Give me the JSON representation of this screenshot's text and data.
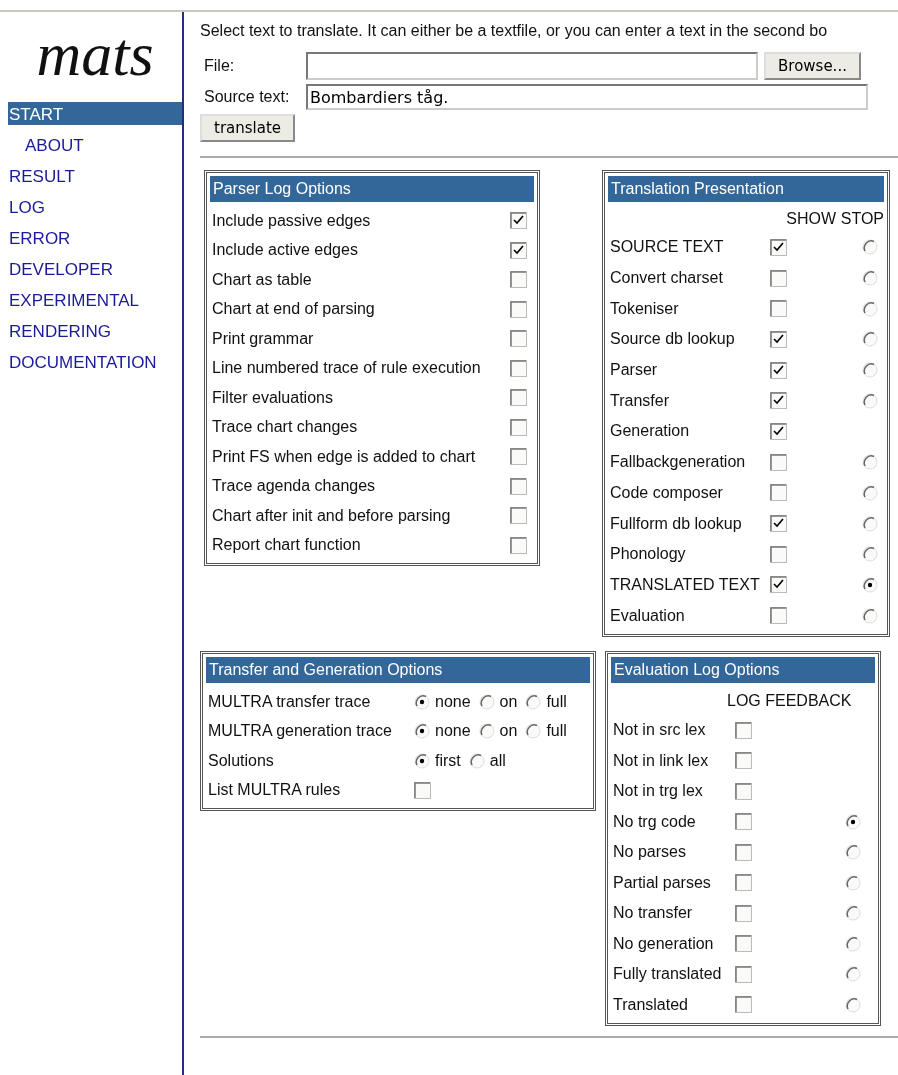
{
  "logo": "mats",
  "nav": [
    {
      "label": "START",
      "selected": true,
      "sub": false
    },
    {
      "label": "ABOUT",
      "selected": false,
      "sub": true
    },
    {
      "label": "RESULT",
      "selected": false,
      "sub": false
    },
    {
      "label": "LOG",
      "selected": false,
      "sub": false
    },
    {
      "label": "ERROR",
      "selected": false,
      "sub": false
    },
    {
      "label": "DEVELOPER",
      "selected": false,
      "sub": false
    },
    {
      "label": "EXPERIMENTAL",
      "selected": false,
      "sub": false
    },
    {
      "label": "RENDERING",
      "selected": false,
      "sub": false
    },
    {
      "label": "DOCUMENTATION",
      "selected": false,
      "sub": false
    }
  ],
  "intro": "Select text to translate. It can either be a textfile, or you can enter a text in the second bo",
  "file_field": {
    "label": "File:",
    "button": "Browse..."
  },
  "source_field": {
    "label": "Source text:",
    "value": "Bombardiers tåg."
  },
  "translate_button": "translate",
  "parser_log": {
    "title": "Parser Log Options",
    "items": [
      {
        "label": "Include passive edges",
        "checked": true
      },
      {
        "label": "Include active edges",
        "checked": true
      },
      {
        "label": "Chart as table",
        "checked": false
      },
      {
        "label": "Chart at end of parsing",
        "checked": false
      },
      {
        "label": "Print grammar",
        "checked": false
      },
      {
        "label": "Line numbered trace of rule execution",
        "checked": false
      },
      {
        "label": "Filter evaluations",
        "checked": false
      },
      {
        "label": "Trace chart changes",
        "checked": false
      },
      {
        "label": "Print FS when edge is added to chart",
        "checked": false
      },
      {
        "label": "Trace agenda changes",
        "checked": false
      },
      {
        "label": "Chart after init and before parsing",
        "checked": false
      },
      {
        "label": "Report chart function",
        "checked": false
      }
    ]
  },
  "translation_presentation": {
    "title": "Translation Presentation",
    "columns": [
      "SHOW",
      "STOP"
    ],
    "items": [
      {
        "label": "SOURCE TEXT",
        "show": true,
        "stop": false
      },
      {
        "label": "Convert charset",
        "show": false,
        "stop": false
      },
      {
        "label": "Tokeniser",
        "show": false,
        "stop": false
      },
      {
        "label": "Source db lookup",
        "show": true,
        "stop": false
      },
      {
        "label": "Parser",
        "show": true,
        "stop": false
      },
      {
        "label": "Transfer",
        "show": true,
        "stop": false
      },
      {
        "label": "Generation",
        "show": true
      },
      {
        "label": "Fallbackgeneration",
        "show": false,
        "stop": false
      },
      {
        "label": "Code composer",
        "show": false,
        "stop": false
      },
      {
        "label": "Fullform db lookup",
        "show": true,
        "stop": false
      },
      {
        "label": "Phonology",
        "show": false,
        "stop": false
      },
      {
        "label": "TRANSLATED TEXT",
        "show": true,
        "stop": true
      },
      {
        "label": "Evaluation",
        "show": false,
        "stop": false
      }
    ]
  },
  "transfer_generation": {
    "title": "Transfer and Generation Options",
    "items": [
      {
        "kind": "radio",
        "label": "MULTRA transfer trace",
        "options": [
          {
            "label": "none",
            "selected": true
          },
          {
            "label": "on",
            "selected": false
          },
          {
            "label": "full",
            "selected": false
          }
        ]
      },
      {
        "kind": "radio",
        "label": "MULTRA generation trace",
        "options": [
          {
            "label": "none",
            "selected": true
          },
          {
            "label": "on",
            "selected": false
          },
          {
            "label": "full",
            "selected": false
          }
        ]
      },
      {
        "kind": "radio",
        "label": "Solutions",
        "options": [
          {
            "label": "first",
            "selected": true
          },
          {
            "label": "all",
            "selected": false
          }
        ]
      },
      {
        "kind": "checkbox",
        "label": "List MULTRA rules",
        "checked": false
      }
    ]
  },
  "evaluation_log": {
    "title": "Evaluation Log Options",
    "columns": [
      "LOG",
      "FEEDBACK"
    ],
    "items": [
      {
        "label": "Not in src lex",
        "log": false
      },
      {
        "label": "Not in link lex",
        "log": false
      },
      {
        "label": "Not in trg lex",
        "log": false
      },
      {
        "label": "No trg code",
        "log": false,
        "feedback": true
      },
      {
        "label": "No parses",
        "log": false,
        "feedback": false
      },
      {
        "label": "Partial parses",
        "log": false,
        "feedback": false
      },
      {
        "label": "No transfer",
        "log": false,
        "feedback": false
      },
      {
        "label": "No generation",
        "log": false,
        "feedback": false
      },
      {
        "label": "Fully translated",
        "log": false,
        "feedback": false
      },
      {
        "label": "Translated",
        "log": false,
        "feedback": false
      }
    ]
  }
}
